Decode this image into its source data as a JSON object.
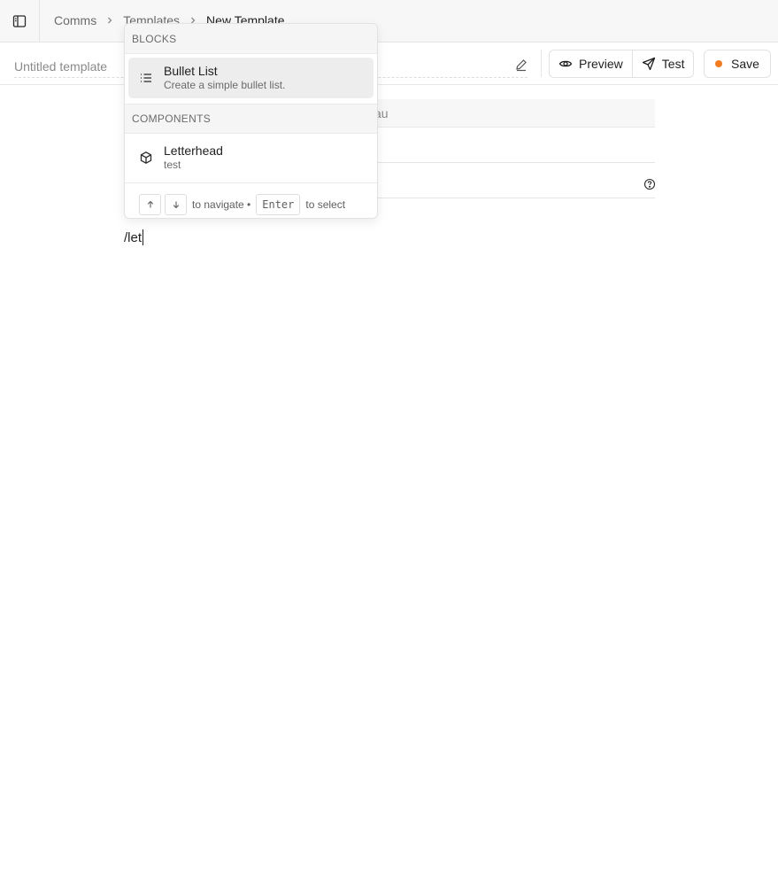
{
  "breadcrumb": {
    "items": [
      "Comms",
      "Templates"
    ],
    "current": "New Template"
  },
  "header": {
    "title_placeholder": "Untitled template",
    "preview_label": "Preview",
    "test_label": "Test",
    "save_label": "Save",
    "save_dot_color": "#f47c20"
  },
  "form": {
    "field1_value": "au"
  },
  "editor": {
    "text": "/let"
  },
  "slash_menu": {
    "blocks_heading": "BLOCKS",
    "blocks": [
      {
        "title": "Bullet List",
        "subtitle": "Create a simple bullet list.",
        "icon": "list-icon"
      }
    ],
    "components_heading": "COMPONENTS",
    "components": [
      {
        "title": "Letterhead",
        "subtitle": "test",
        "icon": "box-icon"
      }
    ],
    "footer": {
      "navigate_text": "to navigate •",
      "enter_key": "Enter",
      "select_text": "to select"
    }
  }
}
